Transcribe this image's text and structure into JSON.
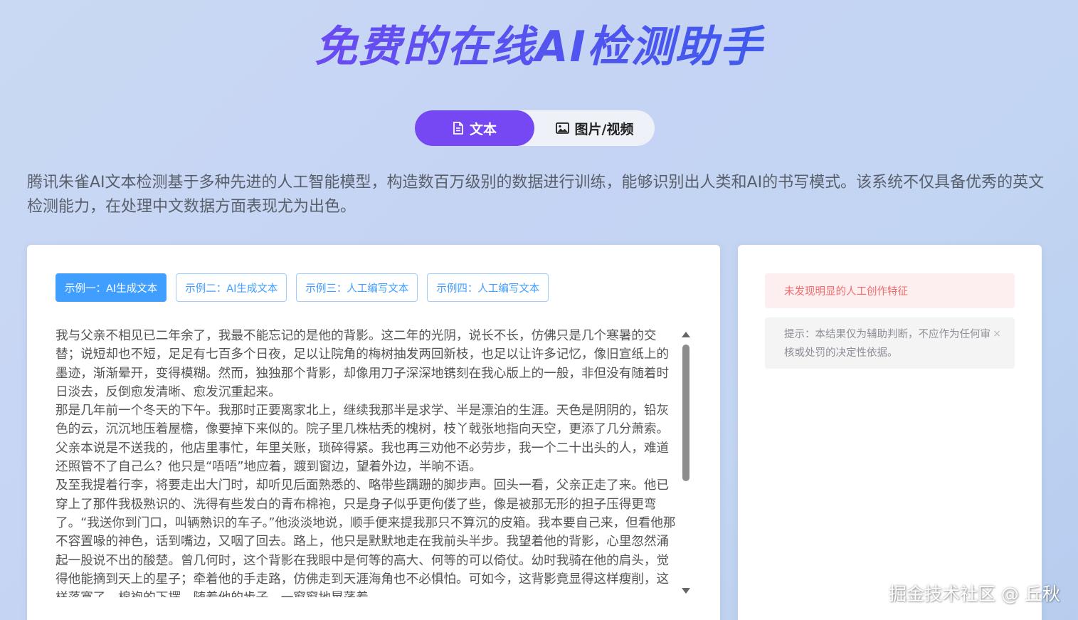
{
  "header": {
    "title": "免费的在线AI检测助手"
  },
  "tabs": [
    {
      "label": "文本",
      "icon": "document-icon",
      "active": true
    },
    {
      "label": "图片/视频",
      "icon": "image-icon",
      "active": false
    }
  ],
  "description": "腾讯朱雀AI文本检测基于多种先进的人工智能模型，构造数百万级别的数据进行训练，能够识别出人类和AI的书写模式。该系统不仅具备优秀的英文检测能力，在处理中文数据方面表现尤为出色。",
  "examples": [
    {
      "label": "示例一：AI生成文本",
      "active": true
    },
    {
      "label": "示例二：AI生成文本",
      "active": false
    },
    {
      "label": "示例三：人工编写文本",
      "active": false
    },
    {
      "label": "示例四：人工编写文本",
      "active": false
    }
  ],
  "input": {
    "value": "我与父亲不相见已二年余了，我最不能忘记的是他的背影。这二年的光阴，说长不长，仿佛只是几个寒暑的交替；说短却也不短，足足有七百多个日夜，足以让院角的梅树抽发两回新枝，也足以让许多记忆，像旧宣纸上的墨迹，渐渐晕开，变得模糊。然而，独独那个背影，却像用刀子深深地镌刻在我心版上的一般，非但没有随着时日淡去，反倒愈发清晰、愈发沉重起来。\n那是几年前一个冬天的下午。我那时正要离家北上，继续我那半是求学、半是漂泊的生涯。天色是阴阴的，铅灰色的云，沉沉地压着屋檐，像要掉下来似的。院子里几株枯秃的槐树，枝丫戟张地指向天空，更添了几分萧索。父亲本说是不送我的，他店里事忙，年里关账，琐碎得紧。我也再三劝他不必劳步，我一个二十出头的人，难道还照管不了自己么？他只是“唔唔”地应着，踱到窗边，望着外边，半晌不语。\n及至我提着行李，将要走出大门时，却听见后面熟悉的、略带些蹒跚的脚步声。回头一看，父亲正走了来。他已穿上了那件我极熟识的、洗得有些发白的青布棉袍，只是身子似乎更佝偻了些，像是被那无形的担子压得更弯了。“我送你到门口，叫辆熟识的车子。”他淡淡地说，顺手便来提我那只不算沉的皮箱。我本要自己来，但看他那不容置喙的神色，话到嘴边，又咽了回去。路上，他只是默默地走在我前头半步。我望着他的背影，心里忽然涌起一股说不出的酸楚。曾几何时，这个背影在我眼中是何等的高大、何等的可以倚仗。幼时我骑在他的肩头，觉得他能摘到天上的星子；牵着他的手走路，仿佛走到天涯海角也不必惧怕。可如今，这背影竟显得这样瘦削，这样落寞了，棉袍的下摆，随着他的步子，一窗窗地晃荡着。"
  },
  "result": {
    "verdict": "未发现明显的人工创作特征",
    "tip": "提示：本结果仅为辅助判断，不应作为任何审核或处罚的决定性依据。",
    "close_symbol": "×"
  },
  "watermark": "掘金技术社区 @ 丘秋",
  "colors": {
    "accent": "#7548f4",
    "link_blue": "#409eff",
    "error_text": "#f06b6b",
    "error_bg": "#fdefef"
  }
}
